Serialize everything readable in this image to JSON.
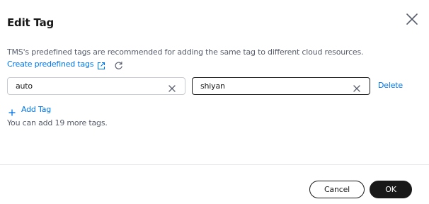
{
  "dialog": {
    "title": "Edit Tag",
    "close_icon": "close-icon"
  },
  "hint": {
    "text": "TMS's predefined tags are recommended for adding the same tag to different cloud resources.",
    "create_link": "Create predefined tags",
    "external_icon": "external-link-icon",
    "refresh_icon": "refresh-icon"
  },
  "tag_row": {
    "key": "auto",
    "value": "shiyan",
    "delete_label": "Delete",
    "clear_icon": "clear-icon"
  },
  "add_tag": {
    "label": "Add Tag",
    "icon": "plus-icon"
  },
  "remaining_text": "You can add 19 more tags.",
  "footer": {
    "cancel_label": "Cancel",
    "ok_label": "OK"
  },
  "colors": {
    "link": "#0073e6",
    "primary_button": "#191919",
    "muted_text": "#575d6c",
    "border": "#c7cad1"
  }
}
